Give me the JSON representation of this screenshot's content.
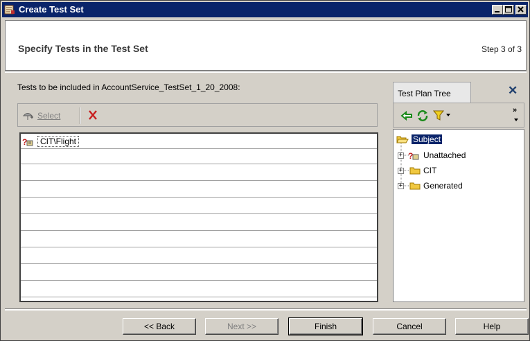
{
  "window": {
    "title": "Create Test Set"
  },
  "header": {
    "title": "Specify Tests in the Test Set",
    "step": "Step 3 of 3"
  },
  "main": {
    "instruction": "Tests to be included in AccountService_TestSet_1_20_2008:",
    "toolbar": {
      "select_label": "Select"
    },
    "tests": [
      {
        "name": "CIT\\Flight",
        "icon": "unattached-test-icon"
      }
    ]
  },
  "test_plan_tree": {
    "tab_label": "Test Plan Tree",
    "root": "Subject",
    "nodes": [
      {
        "label": "Unattached",
        "icon": "unattached-test-icon"
      },
      {
        "label": "CIT",
        "icon": "folder-icon"
      },
      {
        "label": "Generated",
        "icon": "folder-icon"
      }
    ]
  },
  "buttons": {
    "back": "<< Back",
    "next": "Next >>",
    "finish": "Finish",
    "cancel": "Cancel",
    "help": "Help"
  }
}
